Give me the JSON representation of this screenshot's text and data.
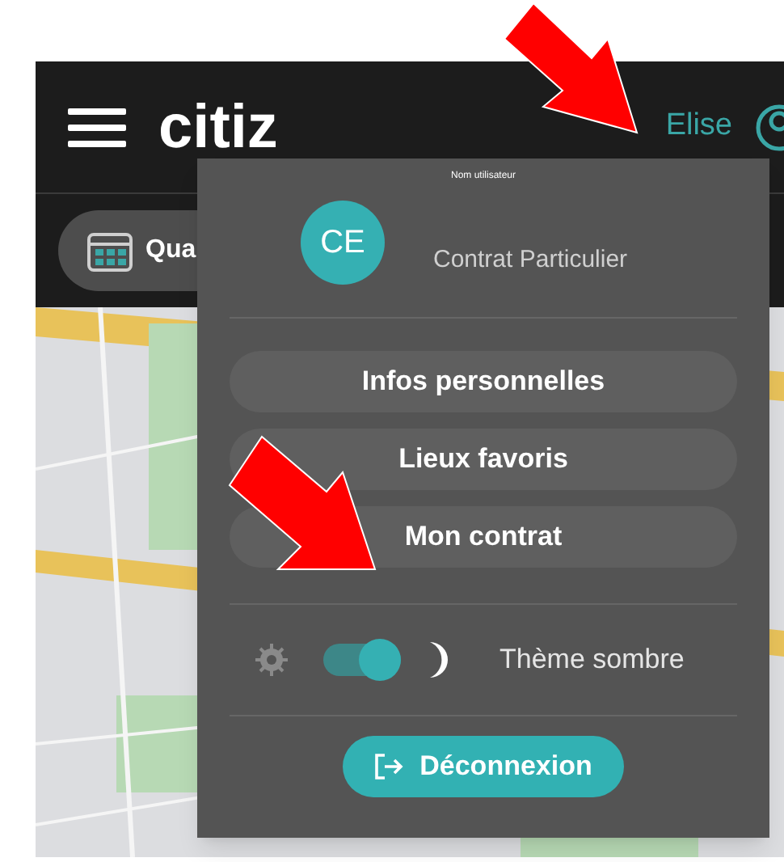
{
  "header": {
    "title": "citiz",
    "username": "Elise"
  },
  "filter_chip": {
    "label": "Qua"
  },
  "account_menu": {
    "caption": "Nom utilisateur",
    "initials": "CE",
    "contract": "Contrat Particulier",
    "items": [
      {
        "label": "Infos personnelles"
      },
      {
        "label": "Lieux favoris"
      },
      {
        "label": "Mon contrat"
      }
    ],
    "theme": {
      "label": "Thème sombre",
      "on": true
    },
    "logout": "Déconnexion"
  }
}
